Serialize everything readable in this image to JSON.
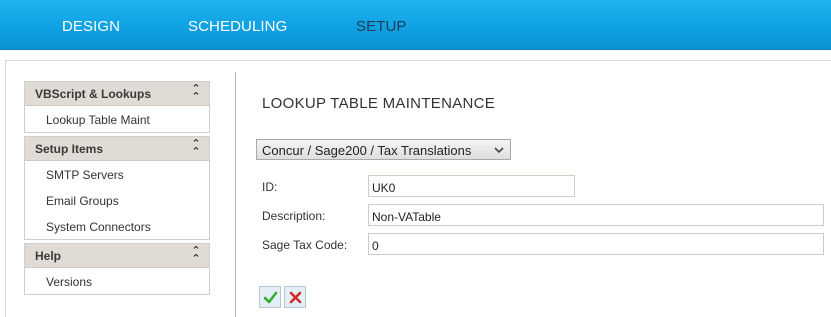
{
  "nav": {
    "items": [
      {
        "label": "DESIGN"
      },
      {
        "label": "SCHEDULING"
      },
      {
        "label": "SETUP"
      }
    ],
    "active": "SETUP",
    "colors": {
      "bar": "#10a2e3",
      "text": "#ffffff",
      "active_text": "#1c3d57"
    }
  },
  "sidebar": {
    "panels": [
      {
        "title": "VBScript & Lookups",
        "items": [
          {
            "label": "Lookup Table Maint"
          }
        ]
      },
      {
        "title": "Setup Items",
        "items": [
          {
            "label": "SMTP Servers"
          },
          {
            "label": "Email Groups"
          },
          {
            "label": "System Connectors"
          }
        ]
      },
      {
        "title": "Help",
        "items": [
          {
            "label": "Versions"
          }
        ]
      }
    ],
    "collapse_icon": "double-chevron-up"
  },
  "main": {
    "title": "LOOKUP TABLE MAINTENANCE",
    "table_select": {
      "value": "Concur / Sage200 / Tax Translations"
    },
    "fields": {
      "id": {
        "label": "ID:",
        "value": "UK0"
      },
      "description": {
        "label": "Description:",
        "value": "Non-VATable"
      },
      "sage_tax_code": {
        "label": "Sage Tax Code:",
        "value": "0"
      }
    },
    "actions": {
      "save_icon": "checkmark-icon",
      "cancel_icon": "x-icon",
      "save_color": "#2fae2f",
      "cancel_color": "#d42a2a"
    }
  }
}
